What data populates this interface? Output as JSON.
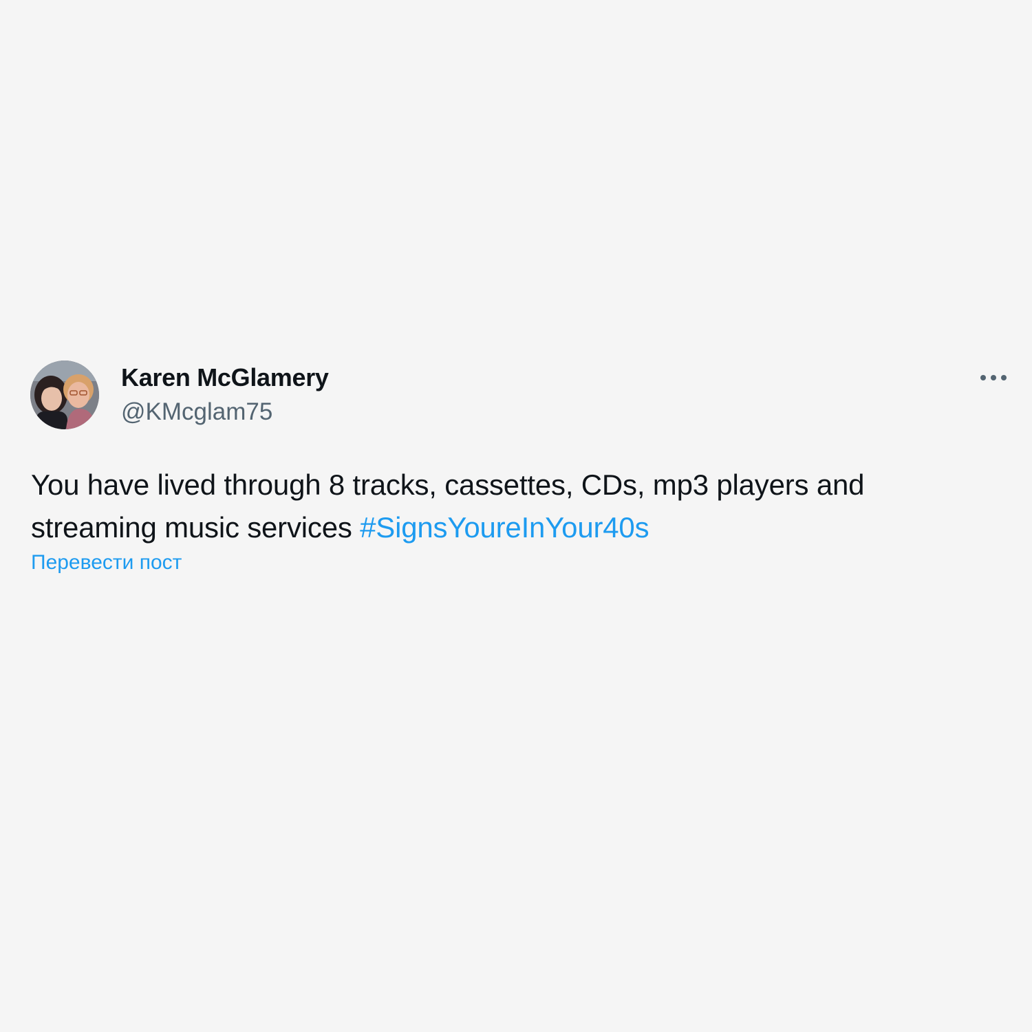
{
  "tweet": {
    "author": {
      "display_name": "Karen McGlamery",
      "handle": "@KMcglam75",
      "avatar_icon": "profile-photo-two-women"
    },
    "more_icon": "more-horizontal-icon",
    "text": "You have lived through 8 tracks, cassettes, CDs, mp3 players and streaming music services",
    "hashtag": "#SignsYoureInYour40s",
    "translate_label": "Перевести пост"
  },
  "colors": {
    "background": "#f5f5f5",
    "text_primary": "#0f1419",
    "text_secondary": "#536471",
    "accent": "#1d9bf0"
  }
}
